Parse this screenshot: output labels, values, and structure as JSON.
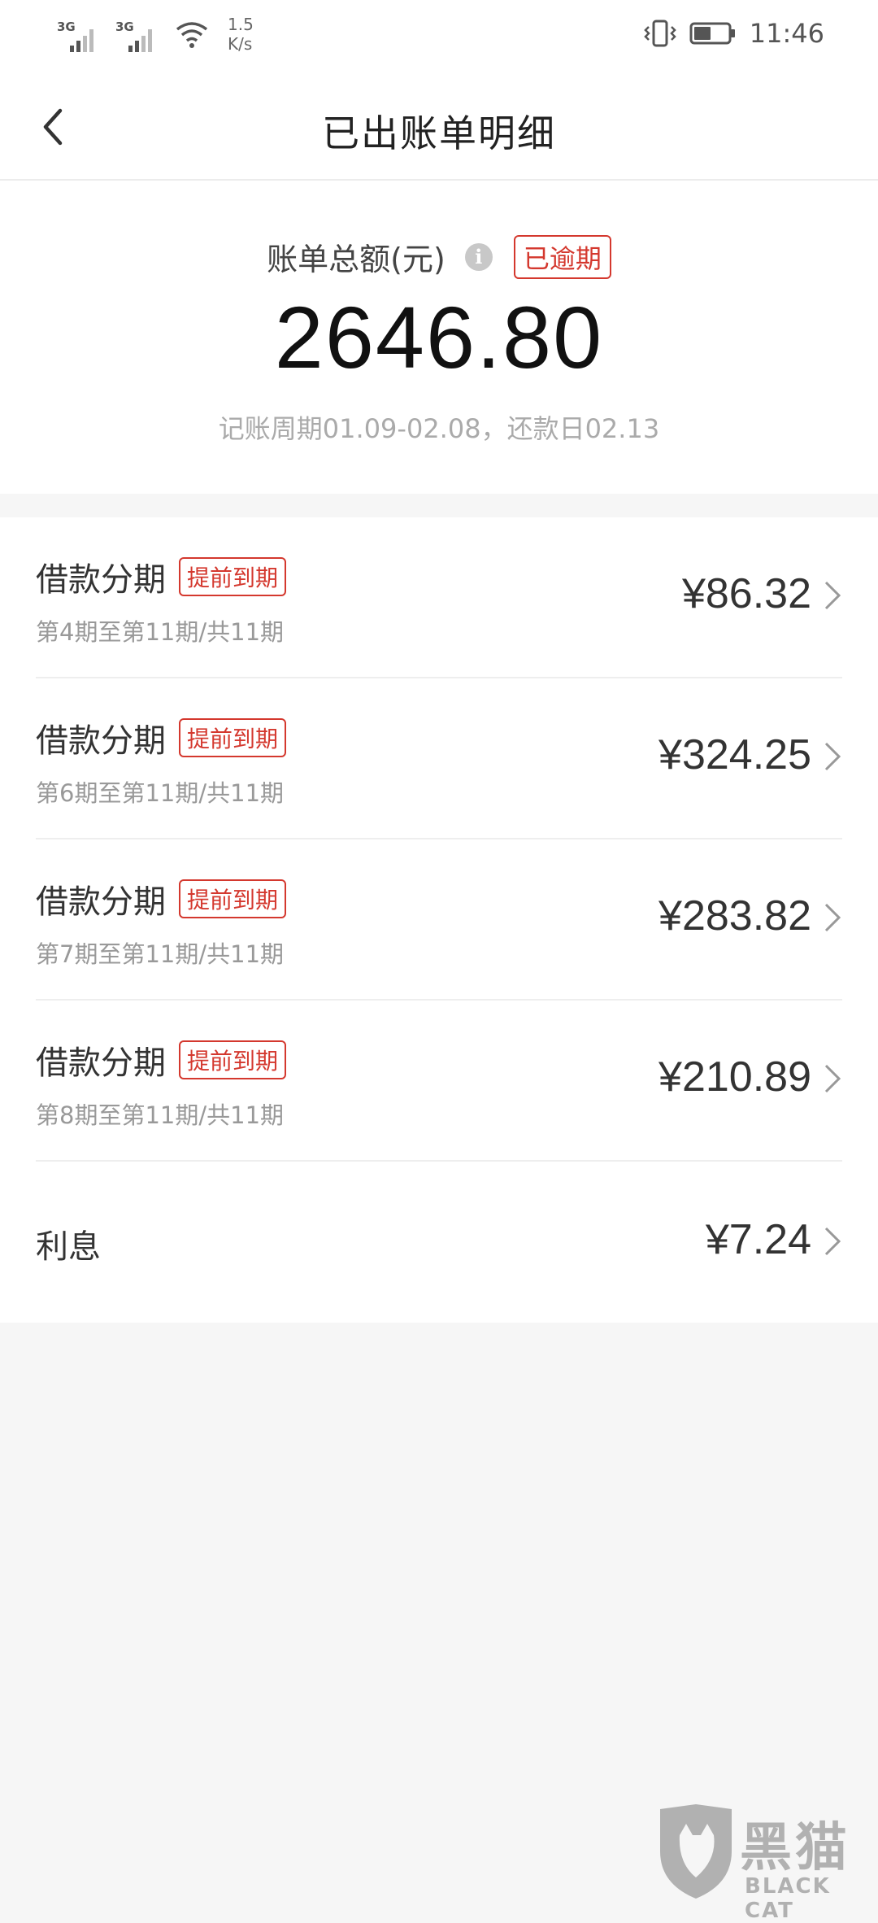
{
  "status_bar": {
    "network_1": "3G",
    "network_2": "3G",
    "speed_value": "1.5",
    "speed_unit": "K/s",
    "time": "11:46"
  },
  "header": {
    "title": "已出账单明细"
  },
  "summary": {
    "label": "账单总额(元)",
    "info_symbol": "i",
    "status_badge": "已逾期",
    "total": "2646.80",
    "cycle": "记账周期01.09-02.08，还款日02.13"
  },
  "items": [
    {
      "title": "借款分期",
      "badge": "提前到期",
      "sub": "第4期至第11期/共11期",
      "amount": "¥86.32"
    },
    {
      "title": "借款分期",
      "badge": "提前到期",
      "sub": "第6期至第11期/共11期",
      "amount": "¥324.25"
    },
    {
      "title": "借款分期",
      "badge": "提前到期",
      "sub": "第7期至第11期/共11期",
      "amount": "¥283.82"
    },
    {
      "title": "借款分期",
      "badge": "提前到期",
      "sub": "第8期至第11期/共11期",
      "amount": "¥210.89"
    }
  ],
  "interest": {
    "title": "利息",
    "amount": "¥7.24"
  },
  "watermark": {
    "cn": "黑猫",
    "en": "BLACK CAT"
  },
  "colors": {
    "accent_red": "#d4382e",
    "background": "#f6f6f6"
  }
}
